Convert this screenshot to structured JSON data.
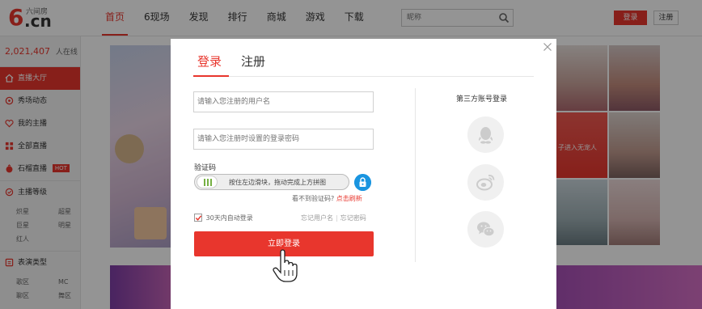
{
  "header": {
    "logo_brand": "六间房",
    "logo_six": "6",
    "logo_cn": ".cn",
    "nav": [
      "首页",
      "6现场",
      "发现",
      "排行",
      "商城",
      "游戏",
      "下载"
    ],
    "search_placeholder": "昵称",
    "login_label": "登录",
    "register_label": "注册"
  },
  "sidebar": {
    "online_count": "2,021,407",
    "online_label": "人在线",
    "items": [
      {
        "label": "直播大厅",
        "icon": "home-icon"
      },
      {
        "label": "秀场动态",
        "icon": "dynamic-icon"
      },
      {
        "label": "我的主播",
        "icon": "heart-icon"
      },
      {
        "label": "全部直播",
        "icon": "grid-icon"
      },
      {
        "label": "石榴直播",
        "icon": "pomegranate-icon",
        "badge": "HOT"
      },
      {
        "label": "主播等级",
        "icon": "level-icon"
      }
    ],
    "levels": [
      "炽星",
      "超星",
      "巨星",
      "明星",
      "红人"
    ],
    "perf_title": "表演类型",
    "perf_types": [
      "歌区",
      "MC",
      "聊区",
      "舞区"
    ]
  },
  "background": {
    "tile_caption": "子进入无宠人"
  },
  "modal": {
    "tab_login": "登录",
    "tab_register": "注册",
    "username_placeholder": "请输入您注册的用户名",
    "password_placeholder": "请输入您注册时设置的登录密码",
    "captcha_label": "验证码",
    "slider_text": "按住左边滑块，拖动完成上方拼图",
    "refresh_question": "看不到验证码?",
    "refresh_link": "点击刷新",
    "auto_login_label": "30天内自动登录",
    "auto_login_checked": true,
    "forgot_username": "忘记用户名",
    "forgot_password": "忘记密码",
    "submit_label": "立即登录",
    "third_party_title": "第三方账号登录",
    "third_party": [
      "qq-icon",
      "weibo-icon",
      "wechat-icon"
    ]
  },
  "colors": {
    "accent": "#e8362d",
    "lock_blue": "#1a95e0",
    "slider_green": "#76b043",
    "social_gray": "#dcdcdc"
  }
}
